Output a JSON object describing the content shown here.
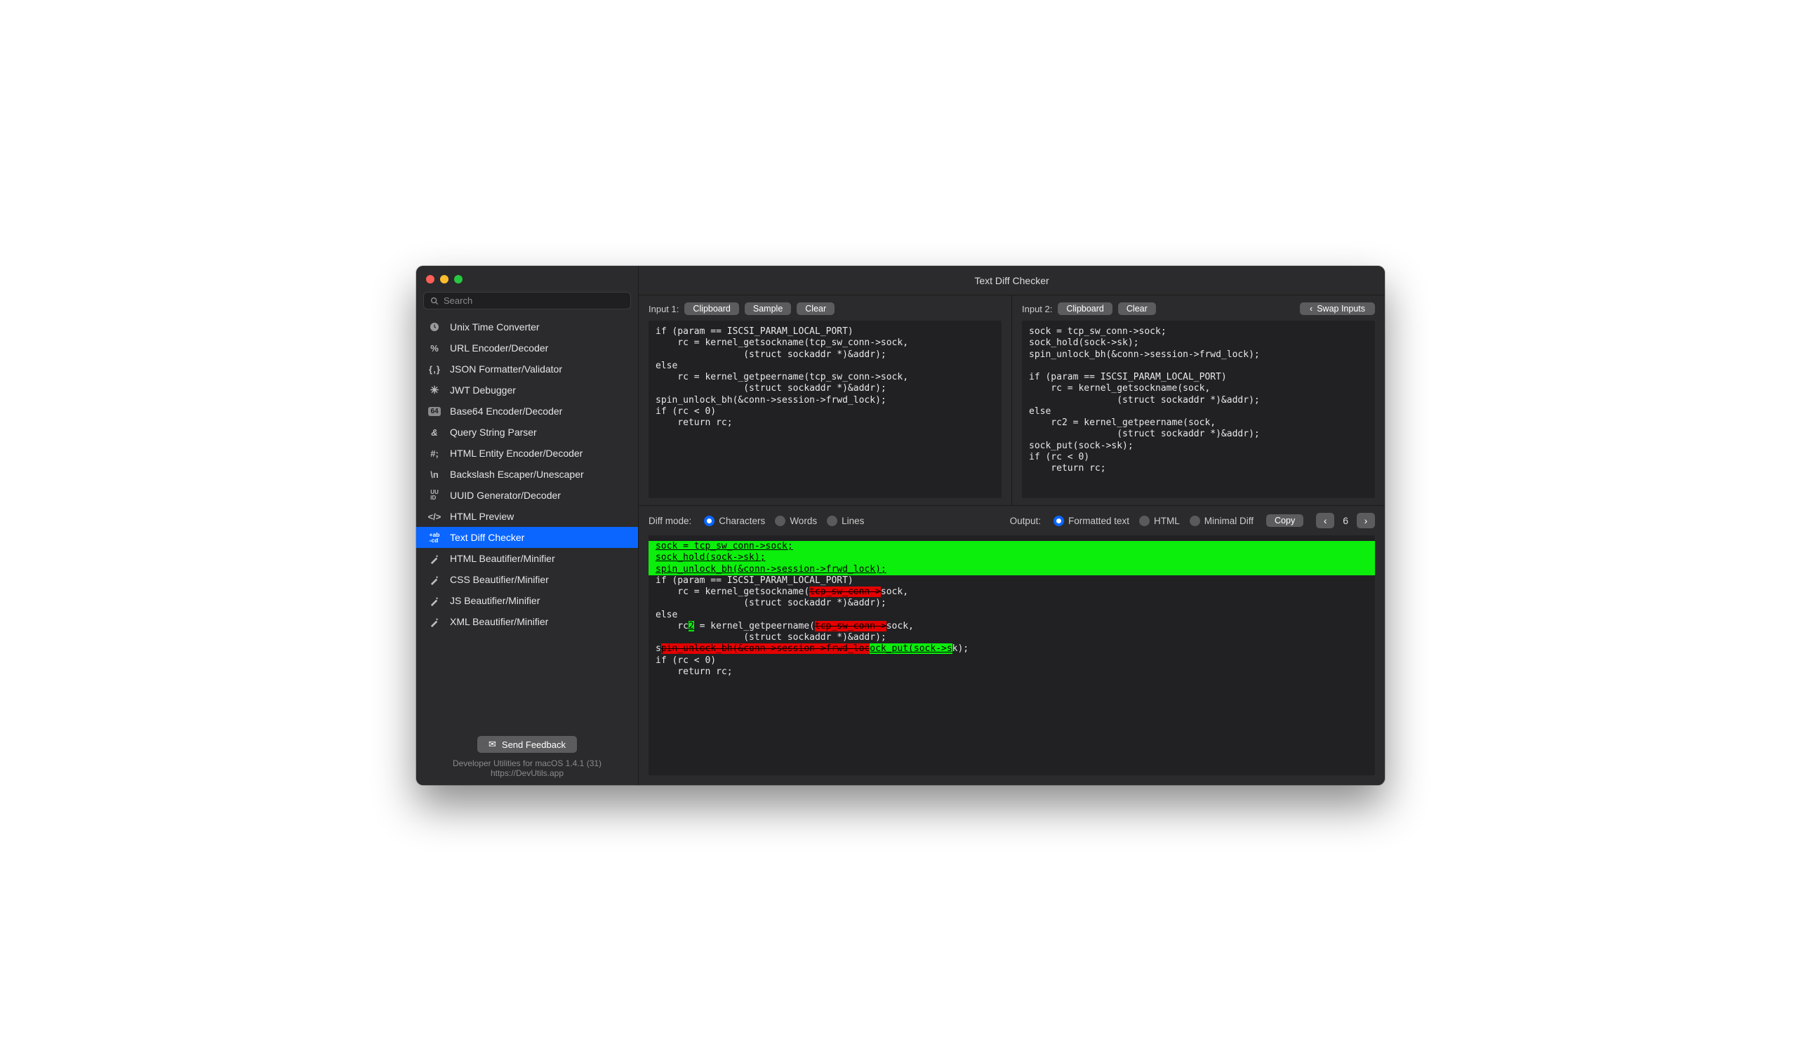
{
  "window": {
    "title": "Text Diff Checker"
  },
  "search": {
    "placeholder": "Search"
  },
  "sidebar": {
    "items": [
      {
        "icon": "clock",
        "label": "Unix Time Converter"
      },
      {
        "icon": "percent",
        "label": "URL Encoder/Decoder"
      },
      {
        "icon": "braces",
        "label": "JSON Formatter/Validator"
      },
      {
        "icon": "jwt",
        "label": "JWT Debugger"
      },
      {
        "icon": "b64",
        "label": "Base64 Encoder/Decoder"
      },
      {
        "icon": "amp",
        "label": "Query String Parser"
      },
      {
        "icon": "hash",
        "label": "HTML Entity Encoder/Decoder"
      },
      {
        "icon": "bslash",
        "label": "Backslash Escaper/Unescaper"
      },
      {
        "icon": "uuid",
        "label": "UUID Generator/Decoder"
      },
      {
        "icon": "tags",
        "label": "HTML Preview"
      },
      {
        "icon": "diff",
        "label": "Text Diff Checker",
        "active": true
      },
      {
        "icon": "wand",
        "label": "HTML Beautifier/Minifier"
      },
      {
        "icon": "wand",
        "label": "CSS Beautifier/Minifier"
      },
      {
        "icon": "wand",
        "label": "JS Beautifier/Minifier"
      },
      {
        "icon": "wand",
        "label": "XML Beautifier/Minifier"
      }
    ]
  },
  "footer": {
    "feedback": "Send Feedback",
    "line1": "Developer Utilities for macOS 1.4.1 (31)",
    "line2": "https://DevUtils.app"
  },
  "inputs": {
    "label1": "Input 1:",
    "label2": "Input 2:",
    "clipboard": "Clipboard",
    "sample": "Sample",
    "clear": "Clear",
    "swap": "Swap Inputs",
    "code1": "if (param == ISCSI_PARAM_LOCAL_PORT)\n    rc = kernel_getsockname(tcp_sw_conn->sock,\n                (struct sockaddr *)&addr);\nelse\n    rc = kernel_getpeername(tcp_sw_conn->sock,\n                (struct sockaddr *)&addr);\nspin_unlock_bh(&conn->session->frwd_lock);\nif (rc < 0)\n    return rc;",
    "code2": "sock = tcp_sw_conn->sock;\nsock_hold(sock->sk);\nspin_unlock_bh(&conn->session->frwd_lock);\n\nif (param == ISCSI_PARAM_LOCAL_PORT)\n    rc = kernel_getsockname(sock,\n                (struct sockaddr *)&addr);\nelse\n    rc2 = kernel_getpeername(sock,\n                (struct sockaddr *)&addr);\nsock_put(sock->sk);\nif (rc < 0)\n    return rc;"
  },
  "diff": {
    "mode_label": "Diff mode:",
    "modes": [
      "Characters",
      "Words",
      "Lines"
    ],
    "mode_selected": "Characters",
    "output_label": "Output:",
    "outputs": [
      "Formatted text",
      "HTML",
      "Minimal Diff"
    ],
    "output_selected": "Formatted text",
    "copy": "Copy",
    "count": "6",
    "lines": [
      {
        "type": "addfull",
        "segs": [
          [
            "",
            "sock = tcp_sw_conn->sock;"
          ]
        ]
      },
      {
        "type": "addfull",
        "segs": [
          [
            "",
            "sock_hold(sock->sk);"
          ]
        ]
      },
      {
        "type": "addfull",
        "segs": [
          [
            "",
            "spin_unlock_bh(&conn->session->frwd_lock);"
          ]
        ]
      },
      {
        "type": "addfull",
        "segs": [
          [
            "",
            ""
          ]
        ]
      },
      {
        "type": "plain",
        "segs": [
          [
            "",
            "if (param == ISCSI_PARAM_LOCAL_PORT)"
          ]
        ]
      },
      {
        "type": "plain",
        "segs": [
          [
            "",
            "    rc = kernel_getsockname("
          ],
          [
            "del",
            "tcp_sw_conn->"
          ],
          [
            "",
            "sock,"
          ]
        ]
      },
      {
        "type": "plain",
        "segs": [
          [
            "",
            "                (struct sockaddr *)&addr);"
          ]
        ]
      },
      {
        "type": "plain",
        "segs": [
          [
            "",
            "else"
          ]
        ]
      },
      {
        "type": "plain",
        "segs": [
          [
            "",
            "    rc"
          ],
          [
            "add",
            "2"
          ],
          [
            "",
            " = kernel_getpeername("
          ],
          [
            "del",
            "tcp_sw_conn->"
          ],
          [
            "",
            "sock,"
          ]
        ]
      },
      {
        "type": "plain",
        "segs": [
          [
            "",
            "                (struct sockaddr *)&addr);"
          ]
        ]
      },
      {
        "type": "plain",
        "segs": [
          [
            "",
            "s"
          ],
          [
            "del",
            "pin_unlock_bh(&conn->session->frwd_loc"
          ],
          [
            "add",
            "ock_put(sock->s"
          ],
          [
            "",
            "k);"
          ]
        ]
      },
      {
        "type": "plain",
        "segs": [
          [
            "",
            "if (rc < 0)"
          ]
        ]
      },
      {
        "type": "plain",
        "segs": [
          [
            "",
            "    return rc;"
          ]
        ]
      }
    ]
  }
}
